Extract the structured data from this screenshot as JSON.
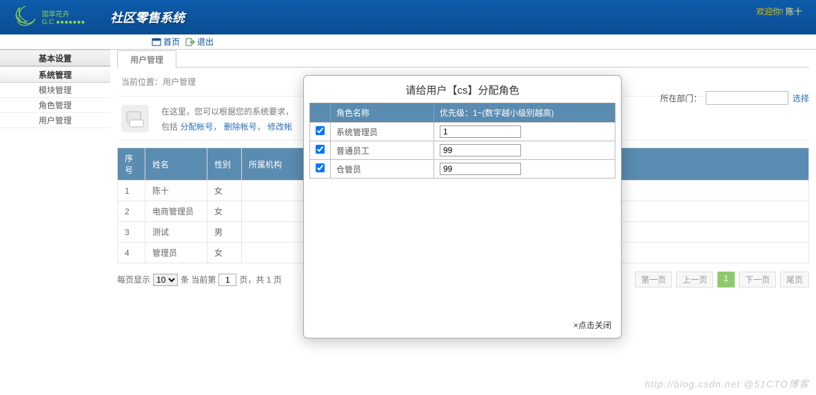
{
  "header": {
    "app_title": "社区零售系统",
    "welcome_prefix": "欢迎你! ",
    "username": "陈十"
  },
  "subnav": {
    "home": "首页",
    "logout": "退出"
  },
  "sidebar": {
    "cat_basic": "基本设置",
    "cat_system": "系统管理",
    "items": [
      {
        "label": "模块管理"
      },
      {
        "label": "角色管理"
      },
      {
        "label": "用户管理"
      }
    ]
  },
  "tab": {
    "label": "用户管理"
  },
  "breadcrumb": {
    "prefix": "当前位置：",
    "val": "用户管理"
  },
  "intro": {
    "line1": "在这里，您可以根据您的系统要求，",
    "line2_prefix": "包括 ",
    "link1": "分配帐号",
    "sep": "，",
    "link2": "删除帐号",
    "link3": "修改帐"
  },
  "dept": {
    "label": "所在部门：",
    "select": "选择"
  },
  "grid": {
    "headers": {
      "idx": "序号",
      "name": "姓名",
      "sex": "性别",
      "org": "所属机构"
    },
    "rows": [
      {
        "idx": "1",
        "name": "陈十",
        "sex": "女",
        "org": ""
      },
      {
        "idx": "2",
        "name": "电商管理员",
        "sex": "女",
        "org": ""
      },
      {
        "idx": "3",
        "name": "测试",
        "sex": "男",
        "org": ""
      },
      {
        "idx": "4",
        "name": "管理员",
        "sex": "女",
        "org": ""
      }
    ]
  },
  "pager": {
    "perpage_label": "每页显示",
    "perpage_val": "10",
    "mid1": "条 当前第",
    "cur_input": "1",
    "mid2": "页，共 1 页",
    "first": "第一页",
    "prev": "上一页",
    "cur": "1",
    "next": "下一页",
    "last": "尾页"
  },
  "modal": {
    "title": "请给用户【cs】分配角色",
    "th_role": "角色名称",
    "th_prio": "优先级：1~(数字越小级别越高)",
    "rows": [
      {
        "role": "系统管理员",
        "prio": "1"
      },
      {
        "role": "普通员工",
        "prio": "99"
      },
      {
        "role": "仓管员",
        "prio": "99"
      }
    ],
    "close": "×点击关闭"
  },
  "watermark": "http://blog.csdn.net @51CTO博客"
}
